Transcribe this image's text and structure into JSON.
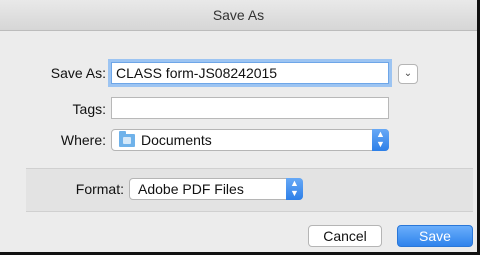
{
  "window": {
    "title": "Save As"
  },
  "form": {
    "save_as": {
      "label": "Save As:",
      "value": "CLASS form-JS08242015"
    },
    "tags": {
      "label": "Tags:",
      "value": ""
    },
    "where": {
      "label": "Where:",
      "value": "Documents",
      "icon": "folder-icon"
    },
    "expand": {
      "icon": "chevron-down-icon",
      "glyph": "⌄"
    }
  },
  "format": {
    "label": "Format:",
    "value": "Adobe PDF Files"
  },
  "buttons": {
    "cancel": "Cancel",
    "save": "Save"
  },
  "colors": {
    "accent": "#2f83ec",
    "focus_ring": "#9cc4f2"
  }
}
